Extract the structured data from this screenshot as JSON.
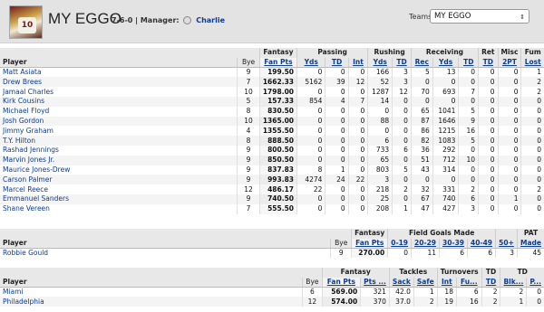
{
  "header": {
    "team_name": "MY EGGO",
    "record": "7-6-0",
    "manager_label": "| Manager:",
    "manager_name": "Charlie",
    "teams_label": "Teams:",
    "teams_selected": "MY EGGO",
    "avatar_number": "10"
  },
  "offense": {
    "groups": {
      "fantasy": "Fantasy",
      "passing": "Passing",
      "rushing": "Rushing",
      "receiving": "Receiving",
      "ret": "Ret",
      "misc": "Misc",
      "fum": "Fum"
    },
    "columns": {
      "player": "Player",
      "bye": "Bye",
      "fanpts": "Fan Pts",
      "pass_yds": "Yds",
      "pass_td": "TD",
      "pass_int": "Int",
      "rush_yds": "Yds",
      "rush_td": "TD",
      "rec": "Rec",
      "rec_yds": "Yds",
      "rec_td": "TD",
      "ret_td": "TD",
      "two_pt": "2PT",
      "lost": "Lost"
    },
    "rows": [
      [
        "Matt Asiata",
        "9",
        "199.50",
        "0",
        "0",
        "0",
        "166",
        "3",
        "5",
        "13",
        "0",
        "0",
        "0",
        "1"
      ],
      [
        "Drew Brees",
        "7",
        "1662.33",
        "5162",
        "39",
        "12",
        "52",
        "3",
        "0",
        "0",
        "0",
        "0",
        "0",
        "2"
      ],
      [
        "Jamaal Charles",
        "10",
        "1798.00",
        "0",
        "0",
        "0",
        "1287",
        "12",
        "70",
        "693",
        "7",
        "0",
        "0",
        "2"
      ],
      [
        "Kirk Cousins",
        "5",
        "157.33",
        "854",
        "4",
        "7",
        "14",
        "0",
        "0",
        "0",
        "0",
        "0",
        "0",
        "0"
      ],
      [
        "Michael Floyd",
        "8",
        "830.50",
        "0",
        "0",
        "0",
        "0",
        "0",
        "65",
        "1041",
        "5",
        "0",
        "0",
        "0"
      ],
      [
        "Josh Gordon",
        "10",
        "1365.00",
        "0",
        "0",
        "0",
        "88",
        "0",
        "87",
        "1646",
        "9",
        "0",
        "0",
        "0"
      ],
      [
        "Jimmy Graham",
        "4",
        "1355.50",
        "0",
        "0",
        "0",
        "0",
        "0",
        "86",
        "1215",
        "16",
        "0",
        "0",
        "0"
      ],
      [
        "T.Y. Hilton",
        "8",
        "888.50",
        "0",
        "0",
        "0",
        "6",
        "0",
        "82",
        "1083",
        "5",
        "0",
        "0",
        "0"
      ],
      [
        "Rashad Jennings",
        "9",
        "800.50",
        "0",
        "0",
        "0",
        "733",
        "6",
        "36",
        "292",
        "0",
        "0",
        "0",
        "0"
      ],
      [
        "Marvin Jones Jr.",
        "9",
        "850.50",
        "0",
        "0",
        "0",
        "65",
        "0",
        "51",
        "712",
        "10",
        "0",
        "0",
        "0"
      ],
      [
        "Maurice Jones-Drew",
        "9",
        "837.83",
        "8",
        "1",
        "0",
        "803",
        "5",
        "43",
        "314",
        "0",
        "0",
        "0",
        "0"
      ],
      [
        "Carson Palmer",
        "9",
        "993.83",
        "4274",
        "24",
        "22",
        "3",
        "0",
        "0",
        "0",
        "0",
        "0",
        "0",
        "0"
      ],
      [
        "Marcel Reece",
        "12",
        "486.17",
        "22",
        "0",
        "0",
        "218",
        "2",
        "32",
        "331",
        "2",
        "0",
        "0",
        "2"
      ],
      [
        "Emmanuel Sanders",
        "9",
        "740.50",
        "0",
        "0",
        "0",
        "25",
        "0",
        "67",
        "740",
        "6",
        "0",
        "1",
        "0"
      ],
      [
        "Shane Vereen",
        "7",
        "555.50",
        "0",
        "0",
        "0",
        "208",
        "1",
        "47",
        "427",
        "3",
        "0",
        "0",
        "0"
      ]
    ]
  },
  "kicker": {
    "groups": {
      "fantasy": "Fantasy",
      "fg": "Field Goals Made",
      "pat": "PAT"
    },
    "columns": {
      "player": "Player",
      "bye": "Bye",
      "fanpts": "Fan Pts",
      "fg0": "0-19",
      "fg20": "20-29",
      "fg30": "30-39",
      "fg40": "40-49",
      "fg50": "50+",
      "made": "Made"
    },
    "rows": [
      [
        "Robbie Gould",
        "9",
        "270.00",
        "0",
        "11",
        "6",
        "6",
        "3",
        "45"
      ]
    ]
  },
  "defense": {
    "groups": {
      "fantasy": "Fantasy",
      "tackles": "Tackles",
      "turnovers": "Turnovers",
      "td": "TD",
      "def_td": "TD"
    },
    "columns": {
      "player": "Player",
      "bye": "Bye",
      "fanpts": "Fan Pts",
      "pts": "Pts ...",
      "sack": "Sack",
      "safe": "Safe",
      "int": "Int",
      "fu": "Fu...",
      "td": "TD",
      "blk": "Blk...",
      "pa": "P..."
    },
    "rows": [
      [
        "Miami",
        "6",
        "569.00",
        "321",
        "42.0",
        "1",
        "18",
        "6",
        "2",
        "2",
        "0"
      ],
      [
        "Philadelphia",
        "12",
        "574.00",
        "370",
        "37.0",
        "2",
        "19",
        "16",
        "2",
        "1",
        "0"
      ]
    ]
  }
}
